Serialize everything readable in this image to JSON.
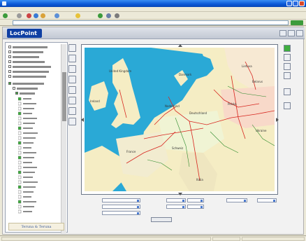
{
  "browser": {
    "title": "",
    "menu": [
      "",
      "",
      "",
      "",
      "",
      ""
    ],
    "address_label": "",
    "address_url": ""
  },
  "app": {
    "logo_text": "LocPoint",
    "footer_logo": "Teruna & Teruna"
  },
  "tree": {
    "items": [
      "",
      "",
      "",
      "",
      "",
      "",
      "",
      "",
      "",
      ""
    ]
  },
  "form": {
    "labels": [
      "",
      "",
      "",
      "",
      "",
      "",
      "",
      ""
    ],
    "values": [
      "",
      "",
      "",
      "",
      "",
      "",
      "",
      ""
    ],
    "submit_label": ""
  },
  "map": {
    "labels": [
      "United Kingdom",
      "Ireland",
      "Deutschland",
      "France",
      "Polska",
      "Belarus",
      "Nederland",
      "Schweiz",
      "Italia",
      "Danmark",
      "Lietuva",
      "Ukraine"
    ],
    "colors": {
      "sea": "#2aa9d6",
      "land": "#f5edc4",
      "roads_major": "#d7261f",
      "roads_minor": "#2a8a2a"
    }
  },
  "colors": {
    "titlebar": "#0a58d6",
    "logo_bg": "#0f3fa3",
    "active_tool": "#3fae3f"
  }
}
